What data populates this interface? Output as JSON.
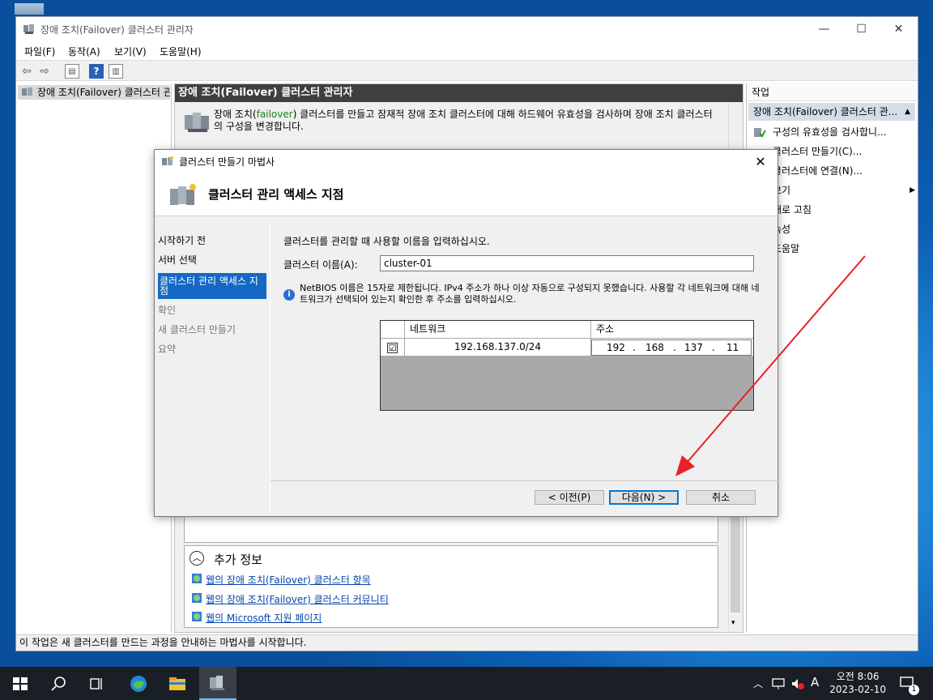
{
  "window": {
    "title": "장애 조치(Failover) 클러스터 관리자",
    "minimize": "—",
    "maximize": "☐",
    "close": "✕"
  },
  "menu": [
    "파일(F)",
    "동작(A)",
    "보기(V)",
    "도움말(H)"
  ],
  "tree": {
    "root": "장애 조치(Failover) 클러스터 관리자"
  },
  "center": {
    "header": "장애 조치(Failover) 클러스터 관리자",
    "desc_prefix": "장애 조치(",
    "desc_failover": "failover",
    "desc_suffix": ") 클러스터를 만들고 잠재적 장애 조치 클러스터에 대해 하드웨어 유효성을 검사하며 장애 조치 클러스터의 구성을 변경합니다."
  },
  "more_info": {
    "title": "추가 정보",
    "links": [
      "웹의 장애 조치(Failover) 클러스터 항목",
      "웹의 장애 조치(Failover) 클러스터 커뮤니티",
      "웹의 Microsoft 지원 페이지"
    ]
  },
  "actions": {
    "header": "작업",
    "selected": "장애 조치(Failover) 클러스터 관...",
    "items": [
      "구성의 유효성을 검사합니...",
      "클러스터 만들기(C)...",
      "클러스터에 연결(N)...",
      "보기",
      "새로 고침",
      "속성",
      "도움말"
    ]
  },
  "status": "이 작업은 새 클러스터를 만드는 과정을 안내하는 마법사를 시작합니다.",
  "wizard": {
    "title": "클러스터 만들기 마법사",
    "heading": "클러스터 관리 액세스 지점",
    "steps": [
      "시작하기 전",
      "서버 선택",
      "클러스터 관리 액세스 지점",
      "확인",
      "새 클러스터 만들기",
      "요약"
    ],
    "prompt": "클러스터를 관리할 때 사용할 이름을 입력하십시오.",
    "name_label": "클러스터 이름(A):",
    "name_value": "cluster-01",
    "info": "NetBIOS 이름은 15자로 제한됩니다. IPv4 주소가 하나 이상 자동으로 구성되지 못했습니다. 사용할 각 네트워크에 대해 네트워크가 선택되어 있는지 확인한 후 주소를 입력하십시오.",
    "grid": {
      "col_network": "네트워크",
      "col_address": "주소",
      "row_network": "192.168.137.0/24",
      "checked": "☑",
      "ip": [
        "192",
        ".",
        "168",
        ".",
        "137",
        ".",
        "11"
      ]
    },
    "buttons": {
      "prev": "< 이전(P)",
      "next": "다음(N) >",
      "cancel": "취소"
    }
  },
  "taskbar": {
    "time": "오전 8:06",
    "date": "2023-02-10",
    "ime": "A",
    "notif_count": "1"
  },
  "colors": {
    "accent": "#1469c6",
    "arrow": "#e8202a",
    "header": "#3f3f3f"
  }
}
